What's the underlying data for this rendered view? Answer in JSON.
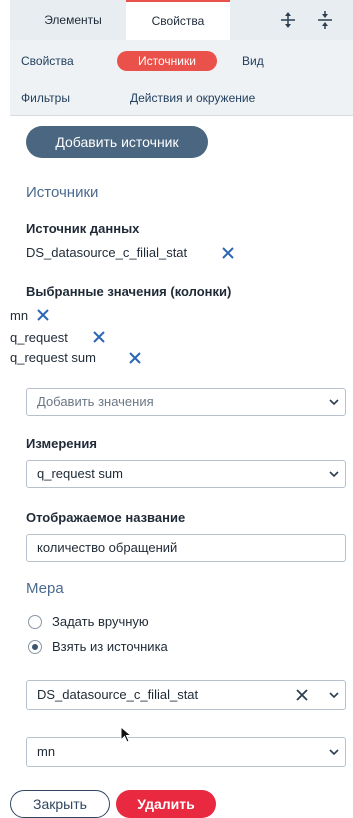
{
  "top_tabs": {
    "elements": "Элементы",
    "properties": "Свойства"
  },
  "sub_tabs": {
    "row1": [
      "Свойства",
      "Источники",
      "Вид"
    ],
    "row2": [
      "Фильтры",
      "Действия и окружение"
    ],
    "active": "Источники"
  },
  "add_source_button": "Добавить источник",
  "sources": {
    "title": "Источники",
    "datasource_label": "Источник данных",
    "datasource_value": "DS_datasource_c_filial_stat",
    "selected_values_label": "Выбранные значения (колонки)",
    "selected_values": [
      "mn",
      "q_request",
      "q_request sum"
    ],
    "add_values_placeholder": "Добавить значения",
    "dimensions_label": "Измерения",
    "dimensions_value": "q_request sum",
    "display_name_label": "Отображаемое название",
    "display_name_value": "количество обращений"
  },
  "measure": {
    "title": "Мера",
    "options": [
      {
        "label": "Задать вручную",
        "checked": false
      },
      {
        "label": "Взять из источника",
        "checked": true
      }
    ],
    "source_select": "DS_datasource_c_filial_stat",
    "column_select": "mn"
  },
  "footer": {
    "close": "Закрыть",
    "delete": "Удалить"
  },
  "colors": {
    "accent": "#e9514a",
    "primary": "#4a6680",
    "danger": "#e8293f",
    "x_icon": "#2d66b5"
  },
  "icons": [
    "expand-icon",
    "collapse-icon",
    "close-x-icon",
    "chevron-down-icon",
    "mouse-cursor-icon"
  ]
}
